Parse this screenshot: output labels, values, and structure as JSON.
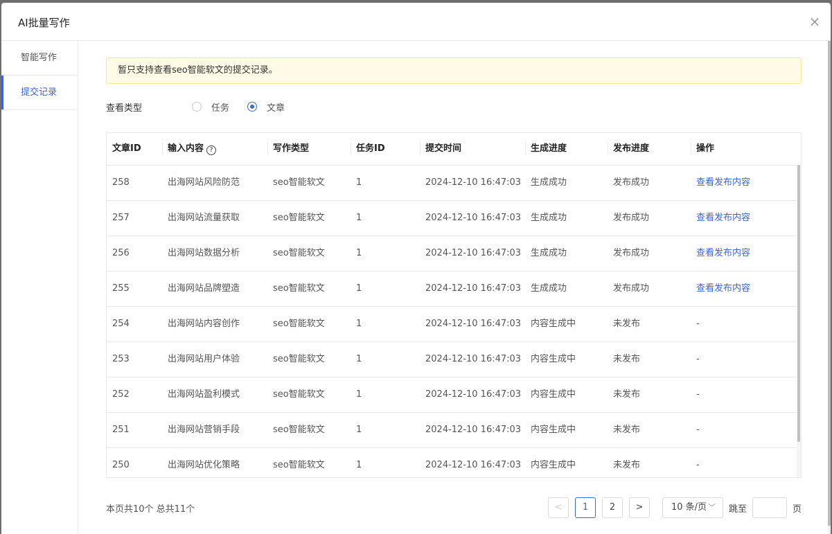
{
  "dialog": {
    "title": "AI批量写作",
    "close_icon": "×"
  },
  "sidebar": {
    "items": [
      {
        "label": "智能写作",
        "active": false
      },
      {
        "label": "提交记录",
        "active": true
      }
    ]
  },
  "notice": "暂只支持查看seo智能软文的提交记录。",
  "filter": {
    "label": "查看类型",
    "options": [
      {
        "label": "任务",
        "checked": false
      },
      {
        "label": "文章",
        "checked": true
      }
    ]
  },
  "table": {
    "headers": [
      "文章ID",
      "输入内容",
      "写作类型",
      "任务ID",
      "提交时间",
      "生成进度",
      "发布进度",
      "操作"
    ],
    "rows": [
      [
        "258",
        "出海网站风险防范",
        "seo智能软文",
        "1",
        "2024-12-10 16:47:03",
        "生成成功",
        "发布成功",
        "查看发布内容"
      ],
      [
        "257",
        "出海网站流量获取",
        "seo智能软文",
        "1",
        "2024-12-10 16:47:03",
        "生成成功",
        "发布成功",
        "查看发布内容"
      ],
      [
        "256",
        "出海网站数据分析",
        "seo智能软文",
        "1",
        "2024-12-10 16:47:03",
        "生成成功",
        "发布成功",
        "查看发布内容"
      ],
      [
        "255",
        "出海网站品牌塑造",
        "seo智能软文",
        "1",
        "2024-12-10 16:47:03",
        "生成成功",
        "发布成功",
        "查看发布内容"
      ],
      [
        "254",
        "出海网站内容创作",
        "seo智能软文",
        "1",
        "2024-12-10 16:47:03",
        "内容生成中",
        "未发布",
        "-"
      ],
      [
        "253",
        "出海网站用户体验",
        "seo智能软文",
        "1",
        "2024-12-10 16:47:03",
        "内容生成中",
        "未发布",
        "-"
      ],
      [
        "252",
        "出海网站盈利模式",
        "seo智能软文",
        "1",
        "2024-12-10 16:47:03",
        "内容生成中",
        "未发布",
        "-"
      ],
      [
        "251",
        "出海网站营销手段",
        "seo智能软文",
        "1",
        "2024-12-10 16:47:03",
        "内容生成中",
        "未发布",
        "-"
      ],
      [
        "250",
        "出海网站优化策略",
        "seo智能软文",
        "1",
        "2024-12-10 16:47:03",
        "内容生成中",
        "未发布",
        "-"
      ]
    ]
  },
  "footer": {
    "total_text": "本页共10个 总共11个",
    "prev": "<",
    "pages": [
      "1",
      "2"
    ],
    "current_page": "1",
    "next": ">",
    "page_size": "10 条/页",
    "jump_label": "跳至",
    "page_unit": "页",
    "jump_value": ""
  },
  "colors": {
    "accent": "#3a64d8",
    "notice_bg": "#fffbe6",
    "notice_border": "#ffe58f"
  }
}
